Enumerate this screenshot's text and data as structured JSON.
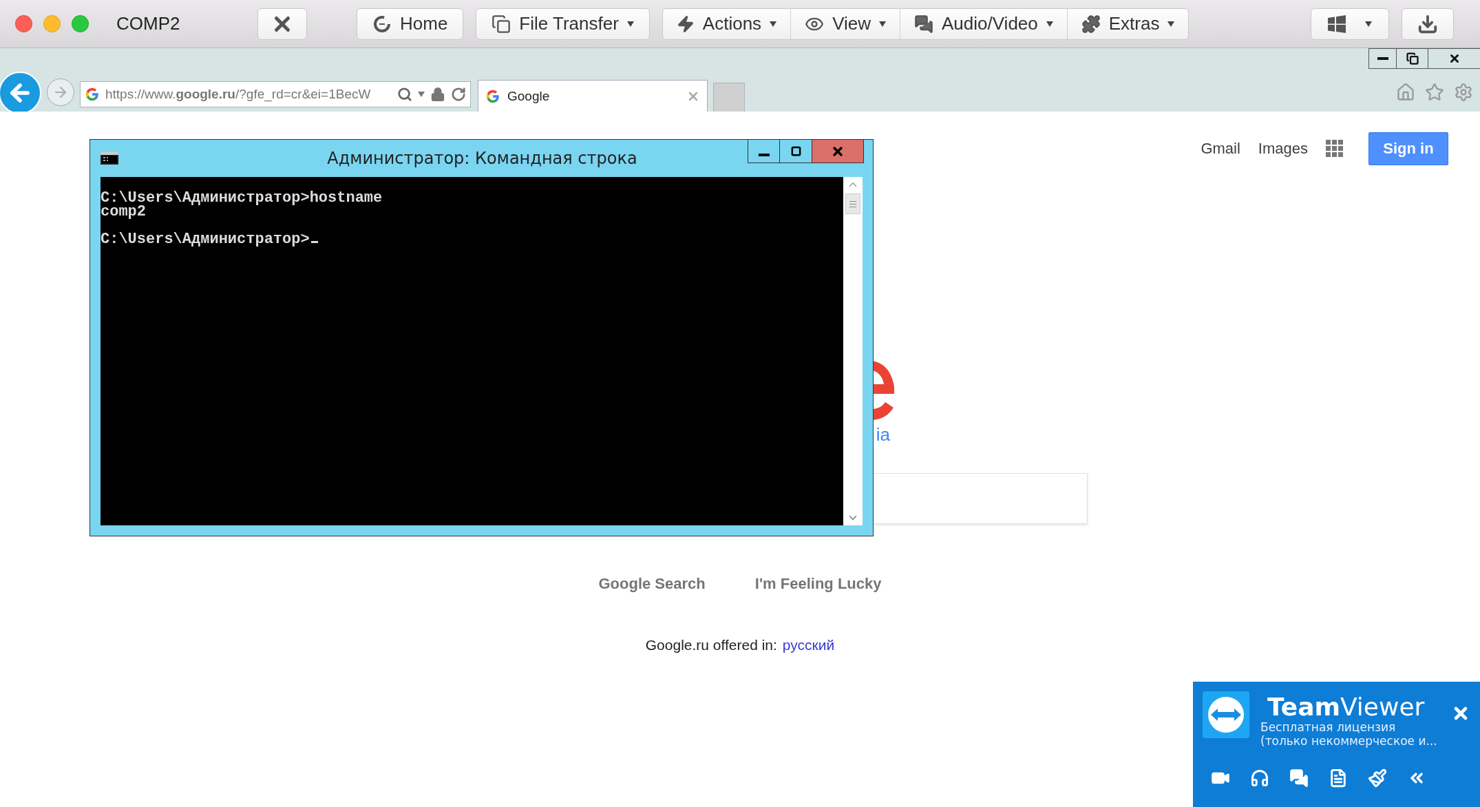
{
  "window": {
    "title": "COMP2"
  },
  "toolbar_buttons": [
    {
      "label": "Home",
      "dropdown": false
    },
    {
      "label": "File Transfer",
      "dropdown": true
    }
  ],
  "toolbar_group": [
    {
      "label": "Actions",
      "dropdown": true
    },
    {
      "label": "View",
      "dropdown": true
    },
    {
      "label": "Audio/Video",
      "dropdown": true
    },
    {
      "label": "Extras",
      "dropdown": true
    }
  ],
  "remote_buttons": [
    {
      "dropdown": true
    },
    {
      "dropdown": false
    }
  ],
  "browser": {
    "url": "https://www.**google.ru**/?gfe_rd=cr&ei=1BecW",
    "tabs": [
      {
        "title": "Google",
        "selected": true
      }
    ]
  },
  "cmd": {
    "title": "Администратор: Командная строка",
    "console": [
      {
        "input": "C:\\Users\\Администратор>hostname",
        "output": "comp2",
        "cursor": false
      },
      {
        "input": "C:\\Users\\Администратор>",
        "cursor": true
      }
    ]
  },
  "google": {
    "header_links": [
      "Gmail",
      "Images"
    ],
    "sign_in": "Sign in",
    "region_visible": "ia",
    "buttons": [
      "Google Search",
      "I'm Feeling Lucky"
    ],
    "offer": {
      "text": "Google.ru offered in:",
      "link": "русский"
    }
  },
  "teamviewer": {
    "title": "**Team**Viewer",
    "license": [
      "Бесплатная лицензия",
      "(только некоммерческое и..."
    ]
  }
}
